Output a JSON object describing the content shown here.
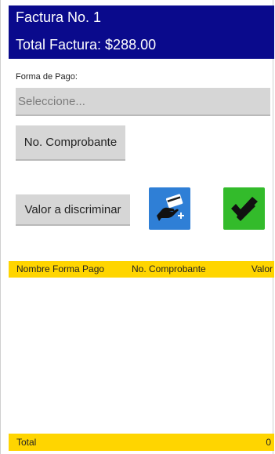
{
  "header": {
    "title": "Factura No. 1",
    "total_label": "Total Factura: $288.00",
    "color": "#0a0a8c"
  },
  "form": {
    "payment_label": "Forma de Pago:",
    "payment_select_value": "Seleccione...",
    "comprobante_button": "No. Comprobante",
    "valor_button": "Valor a discriminar"
  },
  "actions": {
    "add_payment_icon": "credit-card-hand-plus-icon",
    "add_payment_color": "#2f7fd6",
    "confirm_icon": "double-check-icon",
    "confirm_color": "#33bb2b"
  },
  "table": {
    "columns": [
      "Nombre Forma Pago",
      "No. Comprobante",
      "Valor"
    ],
    "rows": [],
    "accent_color": "#ffd500"
  },
  "footer": {
    "total_label": "Total",
    "total_value": "0"
  }
}
